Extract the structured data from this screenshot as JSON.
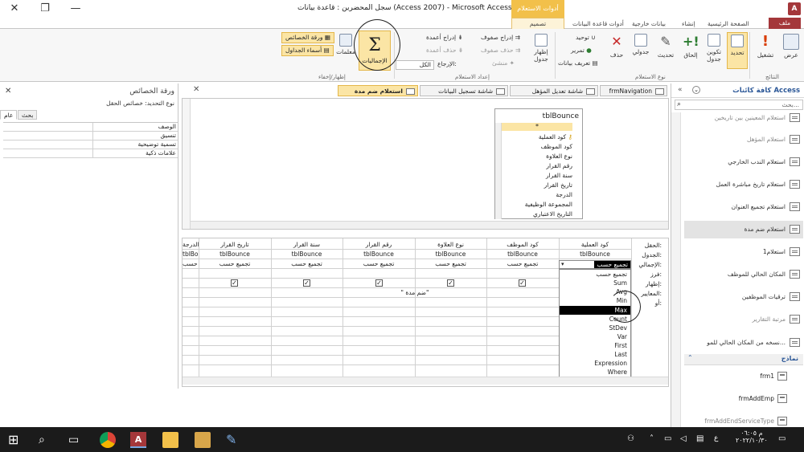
{
  "window": {
    "title": "سجل المحضرين : قاعدة بيانات (Access 2007) - Microsoft Access",
    "contextual_tab": "أدوات الاستعلام",
    "app_icon": "A"
  },
  "ribbon_tabs": {
    "file": "ملف",
    "home": "الصفحة الرئيسية",
    "create": "إنشاء",
    "external": "بيانات خارجية",
    "dbtools": "أدوات قاعدة البيانات",
    "design": "تصميم"
  },
  "ribbon": {
    "results": {
      "view": "عرض",
      "run": "تشغيل",
      "label": "النتائج"
    },
    "query_type": {
      "select": "تحديد",
      "make_table": "تكوين جدول",
      "append": "إلحاق",
      "update": "تحديث",
      "crosstab": "جدولي",
      "delete": "حذف",
      "union": "توحيد",
      "passthrough": "تمرير",
      "data_def": "تعريف بيانات",
      "label": "نوع الاستعلام"
    },
    "setup": {
      "show_table": "إظهار جدول",
      "insert_rows": "إدراج صفوف",
      "delete_rows": "حذف صفوف",
      "builder": "منشئ",
      "insert_cols": "إدراج أعمدة",
      "delete_cols": "حذف أعمدة",
      "return_label": "الإرجاع:",
      "return_value": "الكل",
      "label": "إعداد الاستعلام"
    },
    "show_hide": {
      "totals": "الإجماليات",
      "parameters": "معلمات",
      "property_sheet": "ورقة الخصائص",
      "table_names": "أسماء الجداول",
      "label": "إظهار/إخفاء"
    }
  },
  "property_sheet": {
    "title": "ورقة الخصائص",
    "selection_type": "نوع التحديد:  خصائص الحقل",
    "tab_general": "عام",
    "tab_lookup": "بحث",
    "rows": [
      "الوصف",
      "تنسيق",
      "تسمية توضيحية",
      "علامات ذكية"
    ]
  },
  "doc_tabs": [
    {
      "label": "استعلام ضم مدة",
      "active": true
    },
    {
      "label": "شاشة تسجيل البيانات",
      "active": false
    },
    {
      "label": "شاشة تعديل المؤهل",
      "active": false
    },
    {
      "label": "frmNavigation",
      "active": false
    }
  ],
  "table": {
    "name": "tblBounce",
    "star": "*",
    "fields": [
      "كود العملية",
      "كود الموظف",
      "نوع العلاوة",
      "رقم القرار",
      "سنة القرار",
      "تاريخ القرار",
      "الدرجة",
      "المجموعة الوظيفية",
      "التاريخ الاعتباري"
    ]
  },
  "grid": {
    "row_labels": [
      "الحقل:",
      "الجدول:",
      "الإجمالي:",
      "فرز:",
      "إظهار:",
      "المعايير:",
      "أو:"
    ],
    "columns": [
      {
        "field": "كود العملية",
        "table": "tblBounce",
        "total": "تجميع حسب",
        "show": true,
        "criteria": ""
      },
      {
        "field": "كود الموظف",
        "table": "tblBounce",
        "total": "تجميع حسب",
        "show": true,
        "criteria": ""
      },
      {
        "field": "نوع العلاوة",
        "table": "tblBounce",
        "total": "تجميع حسب",
        "show": true,
        "criteria": ""
      },
      {
        "field": "رقم القرار",
        "table": "tblBounce",
        "total": "تجميع حسب",
        "show": true,
        "criteria": "\" ضم مدة\""
      },
      {
        "field": "سنة القرار",
        "table": "tblBounce",
        "total": "تجميع حسب",
        "show": true,
        "criteria": ""
      },
      {
        "field": "تاريخ القرار",
        "table": "tblBounce",
        "total": "تجميع حسب",
        "show": true,
        "criteria": ""
      },
      {
        "field": "الدرجة",
        "table": "tblBounce",
        "total": "تجميع حسب",
        "show": false,
        "criteria": ""
      }
    ],
    "dropdown_selected": "تجميع حسب",
    "dropdown_options": [
      "تجميع حسب",
      "Sum",
      "Avg",
      "Min",
      "Max",
      "Count",
      "StDev",
      "Var",
      "First",
      "Last",
      "Expression",
      "Where"
    ],
    "dropdown_highlighted": "Max"
  },
  "nav": {
    "title": "كافة كائنات Access",
    "search_placeholder": "بحث...",
    "queries": [
      {
        "label": "استعلام المعينين بين تاريخين",
        "faded": true
      },
      {
        "label": "استعلام المؤهل",
        "faded": true
      },
      {
        "label": "استعلام الندب الخارجي",
        "faded": false
      },
      {
        "label": "استعلام تاريخ مباشرة العمل",
        "faded": false
      },
      {
        "label": "استعلام تجميع العنوان",
        "faded": false
      },
      {
        "label": "استعلام ضم مدة",
        "faded": false,
        "selected": true
      },
      {
        "label": "استعلام1",
        "faded": false
      },
      {
        "label": "المكان الحالي للموظف",
        "faded": false
      },
      {
        "label": "ترقيات الموظفين",
        "faded": false
      },
      {
        "label": "مرتبة التقارير",
        "faded": true
      },
      {
        "label": "نسخه من  المكان الحالي للمو...",
        "faded": false
      }
    ],
    "forms_header": "نماذج",
    "forms": [
      "frm1",
      "frmAddEmp",
      "frmAddEndServiceType"
    ]
  },
  "taskbar": {
    "time": "م ٠٦:٠٥",
    "date": "٢٠٢٢/١٠/٣٠",
    "lang": "ع"
  }
}
